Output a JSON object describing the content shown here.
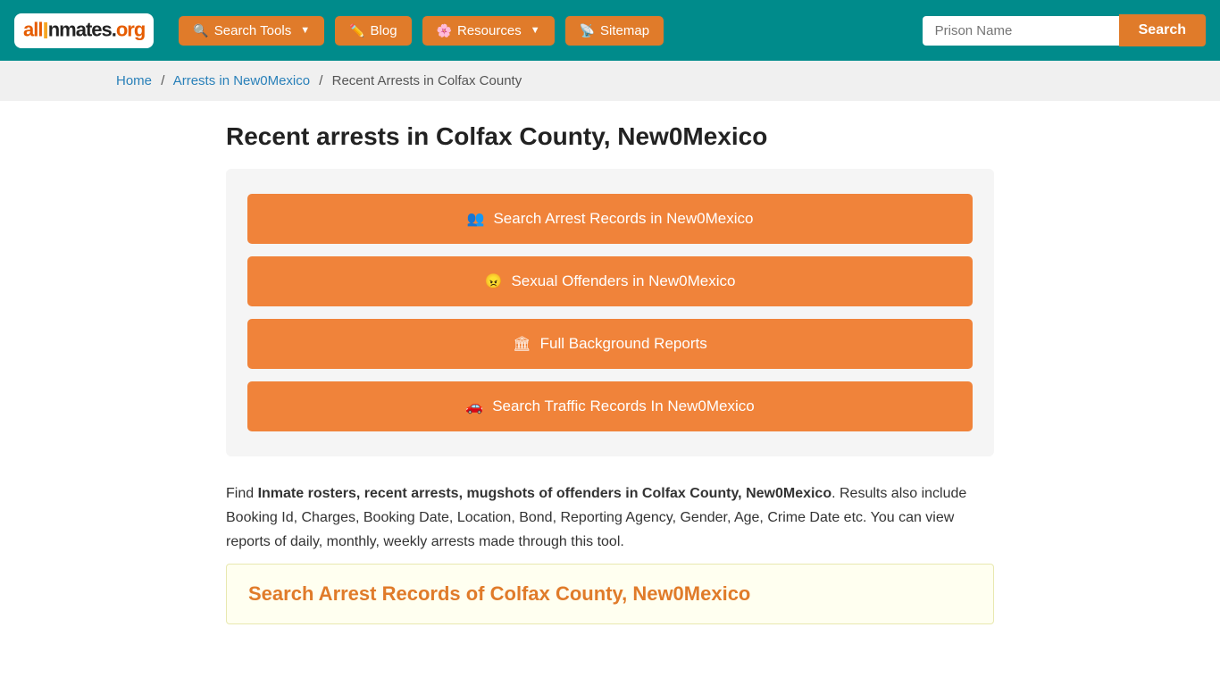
{
  "site": {
    "logo_text": "all Inmates.org"
  },
  "navbar": {
    "search_tools_label": "Search Tools",
    "blog_label": "Blog",
    "resources_label": "Resources",
    "sitemap_label": "Sitemap",
    "prison_input_placeholder": "Prison Name",
    "search_button_label": "Search"
  },
  "breadcrumb": {
    "home": "Home",
    "arrests": "Arrests in New0Mexico",
    "current": "Recent Arrests in Colfax County"
  },
  "page": {
    "title": "Recent arrests in Colfax County, New0Mexico"
  },
  "action_buttons": [
    {
      "id": "btn-arrest-records",
      "icon": "people",
      "label": "Search Arrest Records in New0Mexico"
    },
    {
      "id": "btn-sexual-offenders",
      "icon": "offender",
      "label": "Sexual Offenders in New0Mexico"
    },
    {
      "id": "btn-background-reports",
      "icon": "building",
      "label": "Full Background Reports"
    },
    {
      "id": "btn-traffic-records",
      "icon": "car",
      "label": "Search Traffic Records In New0Mexico"
    }
  ],
  "description": {
    "text_prefix": "Find ",
    "bold_text": "Inmate rosters, recent arrests, mugshots of offenders in Colfax County, New0Mexico",
    "text_suffix": ". Results also include Booking Id, Charges, Booking Date, Location, Bond, Reporting Agency, Gender, Age, Crime Date etc. You can view reports of daily, monthly, weekly arrests made through this tool."
  },
  "bottom_section": {
    "title": "Search Arrest Records of Colfax County, New0Mexico"
  }
}
